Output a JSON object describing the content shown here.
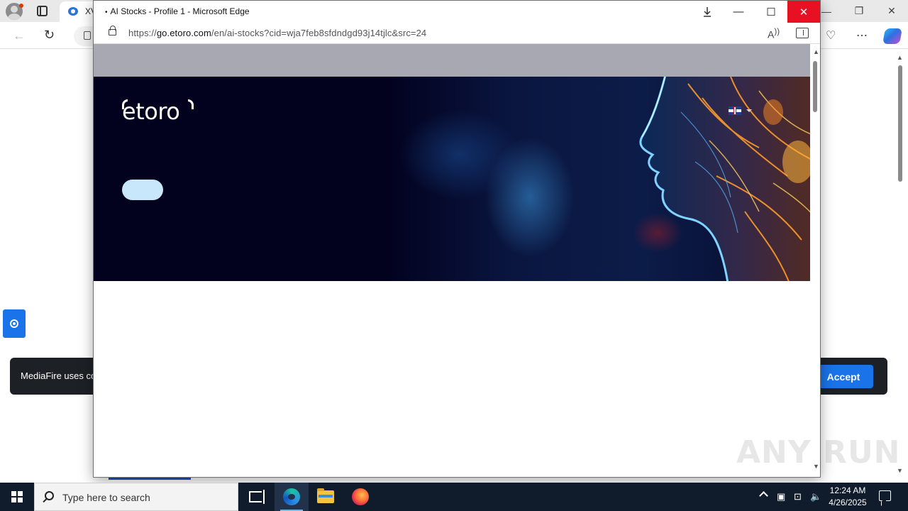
{
  "background_browser": {
    "tab_title": "XV",
    "cookie_banner": {
      "text": "MediaFire uses co",
      "accept_label": "Accept"
    }
  },
  "popup": {
    "window_title": "AI Stocks - Profile 1 - Microsoft Edge",
    "address": {
      "prefix": "https://",
      "domain": "go.etoro.com",
      "path": "/en/ai-stocks?cid=wja7feb8sfdndgd93j14tjlc&src=24"
    },
    "read_aloud_glyph": "A",
    "page": {
      "logo_text": "etoro",
      "language_flag": "uk-flag-icon",
      "gray_band_color": "#a7a8b2",
      "hero_background_color": "#02021f",
      "cta_pill_color": "#c9e7fb"
    }
  },
  "watermark": "ANY RUN",
  "taskbar": {
    "search_placeholder": "Type here to search",
    "time": "12:24 AM",
    "date": "4/26/2025",
    "pinned": [
      "task-view-icon",
      "edge-icon",
      "file-explorer-icon",
      "firefox-icon"
    ]
  },
  "colors": {
    "close_button": "#e81123",
    "accent_blue": "#1a73e8",
    "taskbar": "#101c2b"
  }
}
